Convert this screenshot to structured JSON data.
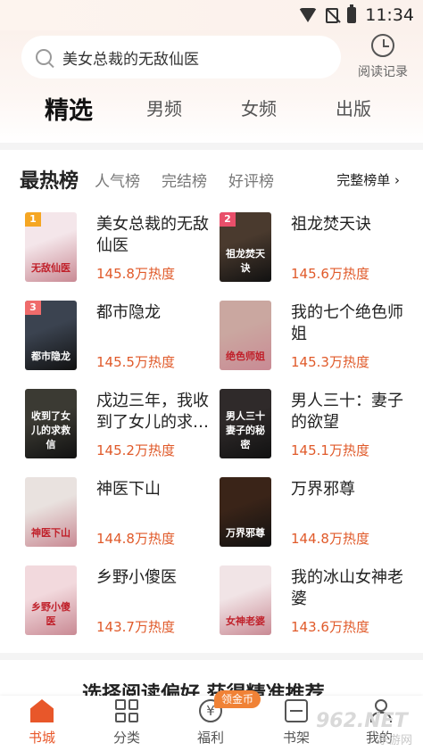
{
  "status_bar": {
    "time": "11:34"
  },
  "search": {
    "placeholder_text": "美女总裁的无敌仙医"
  },
  "history": {
    "label": "阅读记录"
  },
  "tabs": [
    "精选",
    "男频",
    "女频",
    "出版"
  ],
  "ranking": {
    "title": "最热榜",
    "tabs": [
      "人气榜",
      "完结榜",
      "好评榜"
    ],
    "more_label": "完整榜单 ›",
    "books": [
      {
        "rank": "1",
        "title": "美女总裁的无敌仙医",
        "heat": "145.8万热度",
        "cover_text": "无敌仙医",
        "cover_color": "#f4e6ea"
      },
      {
        "rank": "2",
        "title": "祖龙焚天诀",
        "heat": "145.6万热度",
        "cover_text": "祖龙焚天诀",
        "cover_color": "#4a3a2e"
      },
      {
        "rank": "3",
        "title": "都市隐龙",
        "heat": "145.5万热度",
        "cover_text": "都市隐龙",
        "cover_color": "#3b4350"
      },
      {
        "rank": "",
        "title": "我的七个绝色师姐",
        "heat": "145.3万热度",
        "cover_text": "绝色师姐",
        "cover_color": "#caa7a0"
      },
      {
        "rank": "",
        "title": "戍边三年，我收到了女儿的求救信",
        "heat": "145.2万热度",
        "cover_text": "收到了女儿的求救信",
        "cover_color": "#3b3a33"
      },
      {
        "rank": "",
        "title": "男人三十：妻子的欲望",
        "heat": "145.1万热度",
        "cover_text": "男人三十 妻子的秘密",
        "cover_color": "#2f2a2a"
      },
      {
        "rank": "",
        "title": "神医下山",
        "heat": "144.8万热度",
        "cover_text": "神医下山",
        "cover_color": "#e9e2df"
      },
      {
        "rank": "",
        "title": "万界邪尊",
        "heat": "144.8万热度",
        "cover_text": "万界邪尊",
        "cover_color": "#3a2418"
      },
      {
        "rank": "",
        "title": "乡野小傻医",
        "heat": "143.7万热度",
        "cover_text": "乡野小傻医",
        "cover_color": "#f2d9dd"
      },
      {
        "rank": "",
        "title": "我的冰山女神老婆",
        "heat": "143.6万热度",
        "cover_text": "女神老婆",
        "cover_color": "#f1e4e6"
      }
    ]
  },
  "promo_text": "选择阅读偏好  获得精准推荐",
  "nav": {
    "items": [
      "书城",
      "分类",
      "福利",
      "书架",
      "我的"
    ],
    "coin_badge": "领金币",
    "coin_glyph": "¥"
  },
  "watermark": {
    "main": "962.NET",
    "sub": "乐游网"
  },
  "colors": {
    "accent": "#e8572a",
    "heat": "#e05a2a",
    "badge_1": "#f5a623",
    "badge_2": "#e94f6a",
    "badge_3": "#ef6b6b"
  }
}
